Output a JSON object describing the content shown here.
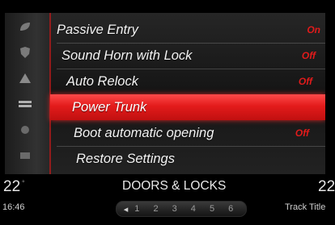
{
  "menu": {
    "rows": [
      {
        "label": "Passive Entry",
        "value": "On",
        "selected": false
      },
      {
        "label": "Sound Horn with Lock",
        "value": "Off",
        "selected": false
      },
      {
        "label": "Auto Relock",
        "value": "Off",
        "selected": false
      },
      {
        "label": "Power Trunk",
        "value": "",
        "selected": true
      },
      {
        "label": "Boot automatic opening",
        "value": "Off",
        "selected": false
      },
      {
        "label": "Restore Settings",
        "value": "",
        "selected": false
      }
    ],
    "icons": [
      "leaf-icon",
      "shield-icon",
      "warning-icon",
      "trunk-icon",
      "circle-icon",
      "rectangle-icon"
    ]
  },
  "status": {
    "temp_left": "22",
    "temp_unit": "°",
    "temp_right": "22",
    "time": "16:46",
    "title": "DOORS & LOCKS",
    "track": "Track Title",
    "pager_arrow": "◂",
    "pager_pages": "1 2 3 4 5 6"
  },
  "colors": {
    "accent": "#e31b1b",
    "value_red": "#e01b1b"
  }
}
